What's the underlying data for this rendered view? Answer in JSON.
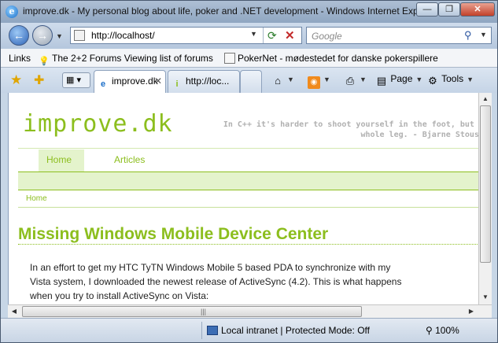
{
  "window": {
    "title": "improve.dk - My personal blog about life, poker and .NET development - Windows Internet Explorer",
    "min_symbol": "—",
    "max_symbol": "❐",
    "close_symbol": "✕"
  },
  "navigation": {
    "address": "http://localhost/",
    "search_placeholder": "Google"
  },
  "links_bar": {
    "label": "Links",
    "items": [
      {
        "text": "The 2+2 Forums Viewing list of forums",
        "icon": "lightbulb-icon"
      },
      {
        "text": "PokerNet - mødestedet for danske pokerspillere",
        "icon": "page-icon"
      }
    ]
  },
  "tabs": [
    {
      "label": "improve.dk",
      "active": true
    },
    {
      "label": "http://loc...",
      "active": false
    }
  ],
  "commands": {
    "page": "Page",
    "tools": "Tools"
  },
  "page": {
    "blog_title": "improve.dk",
    "tagline_lines": [
      "In C++ it's harder to shoot yourself in the foot, but wh",
      "whole leg. - Bjarne Stoustr"
    ],
    "nav": [
      {
        "label": "Home",
        "active": true
      },
      {
        "label": "Articles",
        "active": false
      }
    ],
    "breadcrumb": "Home",
    "post_title": "Missing Windows Mobile Device Center",
    "body_lines": [
      "In an effort to get my HTC TyTN Windows Mobile 5 based PDA to synchronize with my",
      "Vista system, I downloaded the newest release of ActiveSync (4.2). This is what happens",
      "when you try to install ActiveSync on Vista:"
    ]
  },
  "status": {
    "zone": "Local intranet | Protected Mode: Off",
    "zoom": "100%"
  },
  "colors": {
    "accent_green": "#8cbe1e",
    "band_green": "#e4f3cc",
    "chrome_blue": "#c7d6e6"
  }
}
